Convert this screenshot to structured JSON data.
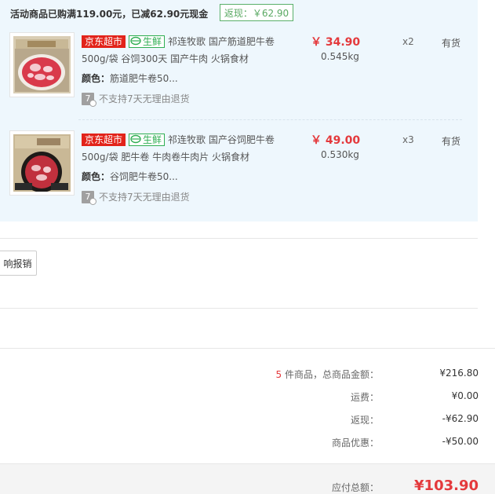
{
  "promo": {
    "text": "活动商品已购满119.00元，已减62.90元现金",
    "rebate": "返现：￥62.90"
  },
  "items": [
    {
      "tag_jd": "京东超市",
      "tag_fresh": "生鲜",
      "title": "祁连牧歌 国产筋道肥牛卷 500g/袋 谷饲300天 国产牛肉 火锅食材",
      "color_label": "颜色：",
      "color_value": "筋道肥牛卷50...",
      "return_icon": "7",
      "return_text": "不支持7天无理由退货",
      "price": "￥ 34.90",
      "weight": "0.545kg",
      "qty": "x2",
      "stock": "有货"
    },
    {
      "tag_jd": "京东超市",
      "tag_fresh": "生鲜",
      "title": "祁连牧歌 国产谷饲肥牛卷 500g/袋 肥牛卷 牛肉卷牛肉片 火锅食材",
      "color_label": "颜色：",
      "color_value": "谷饲肥牛卷50...",
      "return_icon": "7",
      "return_text": "不支持7天无理由退货",
      "price": "￥ 49.00",
      "weight": "0.530kg",
      "qty": "x3",
      "stock": "有货"
    }
  ],
  "invoice_button": "响报销",
  "summary": {
    "count": "5",
    "count_suffix": " 件商品，总商品金额：",
    "goods_total": "¥216.80",
    "shipping_label": "运费：",
    "shipping_value": "¥0.00",
    "rebate_label": "返现：",
    "rebate_value": "-¥62.90",
    "discount_label": "商品优惠：",
    "discount_value": "-¥50.00",
    "payable_label": "应付总额：",
    "payable_value": "¥103.90"
  },
  "colors": {
    "accent_red": "#e4393c",
    "jd_red": "#e2231a",
    "fresh_green": "#2fae53",
    "panel_blue": "#eef7fd"
  }
}
